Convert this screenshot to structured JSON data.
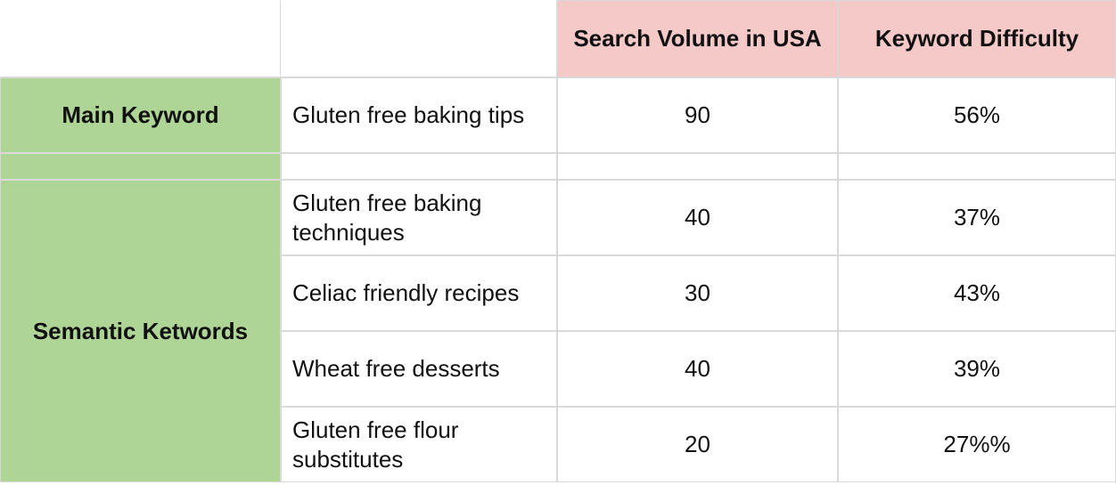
{
  "headers": {
    "col_vol": "Search Volume in USA",
    "col_diff": "Keyword Difficulty"
  },
  "row_labels": {
    "main": "Main Keyword",
    "semantic": "Semantic Ketwords"
  },
  "main_row": {
    "keyword": "Gluten free baking tips",
    "volume": "90",
    "difficulty": "56%"
  },
  "semantic_rows": [
    {
      "keyword": "Gluten free baking techniques",
      "volume": "40",
      "difficulty": "37%"
    },
    {
      "keyword": "Celiac friendly recipes",
      "volume": "30",
      "difficulty": "43%"
    },
    {
      "keyword": "Wheat free desserts",
      "volume": "40",
      "difficulty": "39%"
    },
    {
      "keyword": "Gluten free flour substitutes",
      "volume": "20",
      "difficulty": "27%%"
    }
  ]
}
